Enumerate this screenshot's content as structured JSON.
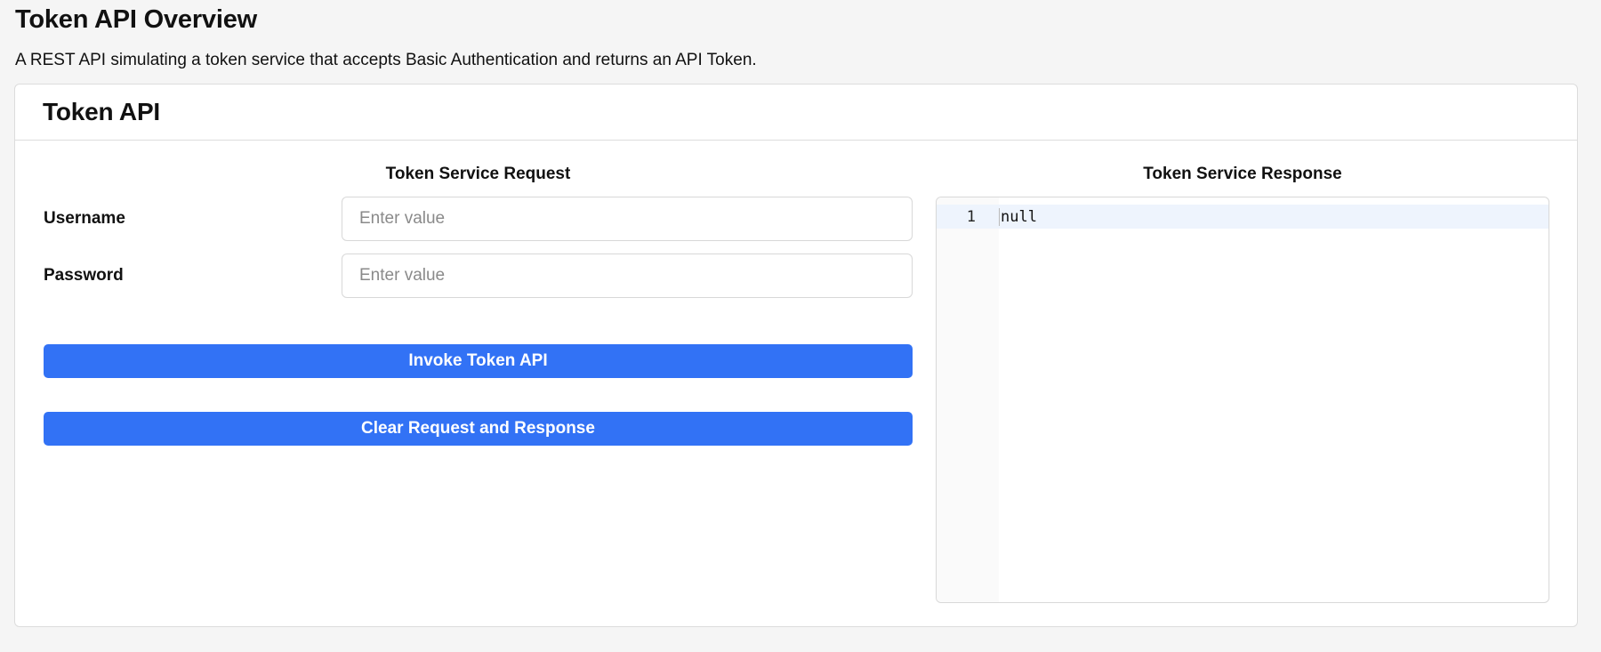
{
  "page": {
    "title": "Token API Overview",
    "description": "A REST API simulating a token service that accepts Basic Authentication and returns an API Token."
  },
  "card": {
    "title": "Token API"
  },
  "request": {
    "title": "Token Service Request",
    "username_label": "Username",
    "username_placeholder": "Enter value",
    "username_value": "",
    "password_label": "Password",
    "password_placeholder": "Enter value",
    "password_value": "",
    "invoke_button": "Invoke Token API",
    "clear_button": "Clear Request and Response"
  },
  "response": {
    "title": "Token Service Response",
    "lines": [
      {
        "number": "1",
        "text": "null"
      }
    ]
  },
  "colors": {
    "primary_button": "#3272f5",
    "active_line_highlight": "#eef4fd"
  }
}
